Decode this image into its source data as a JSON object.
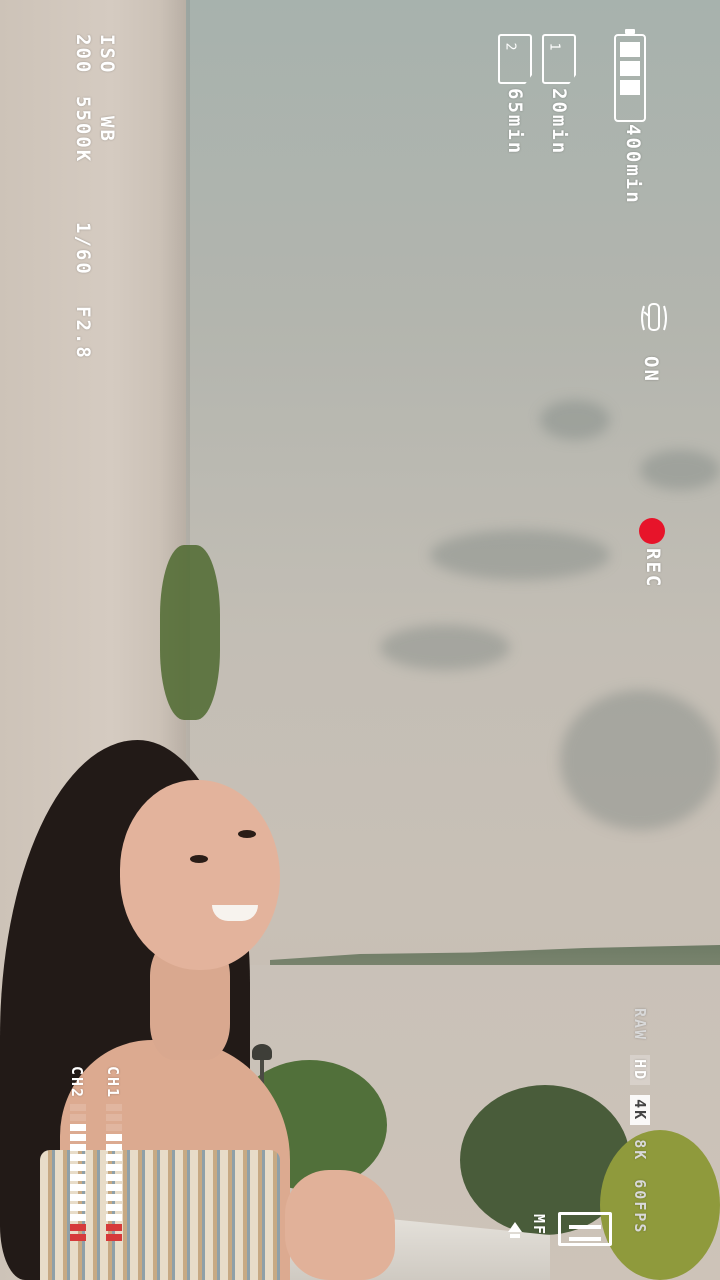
{
  "hud": {
    "battery": {
      "remaining": "400min",
      "level": 0.75
    },
    "storage": [
      {
        "slot": "1",
        "remaining": "20min"
      },
      {
        "slot": "2",
        "remaining": "65min"
      }
    ],
    "exposure": {
      "iso_label": "ISO",
      "iso_value": "200",
      "wb_label": "WB",
      "wb_value": "5500K",
      "shutter": "1/60",
      "aperture": "F2.8"
    },
    "stabilization": {
      "state": "ON",
      "icon": "stabilizer-hand-icon"
    },
    "recording": {
      "label": "REC",
      "color": "#e7142a",
      "icon": "record-dot-icon"
    },
    "formats": {
      "raw": "RAW",
      "hd": "HD",
      "k4": "4K",
      "k8": "8K",
      "fps": "60FPS"
    },
    "focus": {
      "mode": "MF",
      "icon": "focus-pointer-icon"
    },
    "shooting_mode": {
      "icon": "manual-mode-icon"
    },
    "audio": {
      "ch1": {
        "label": "CH1",
        "level": 0.8
      },
      "ch2": {
        "label": "CH2",
        "level": 0.85
      }
    }
  }
}
